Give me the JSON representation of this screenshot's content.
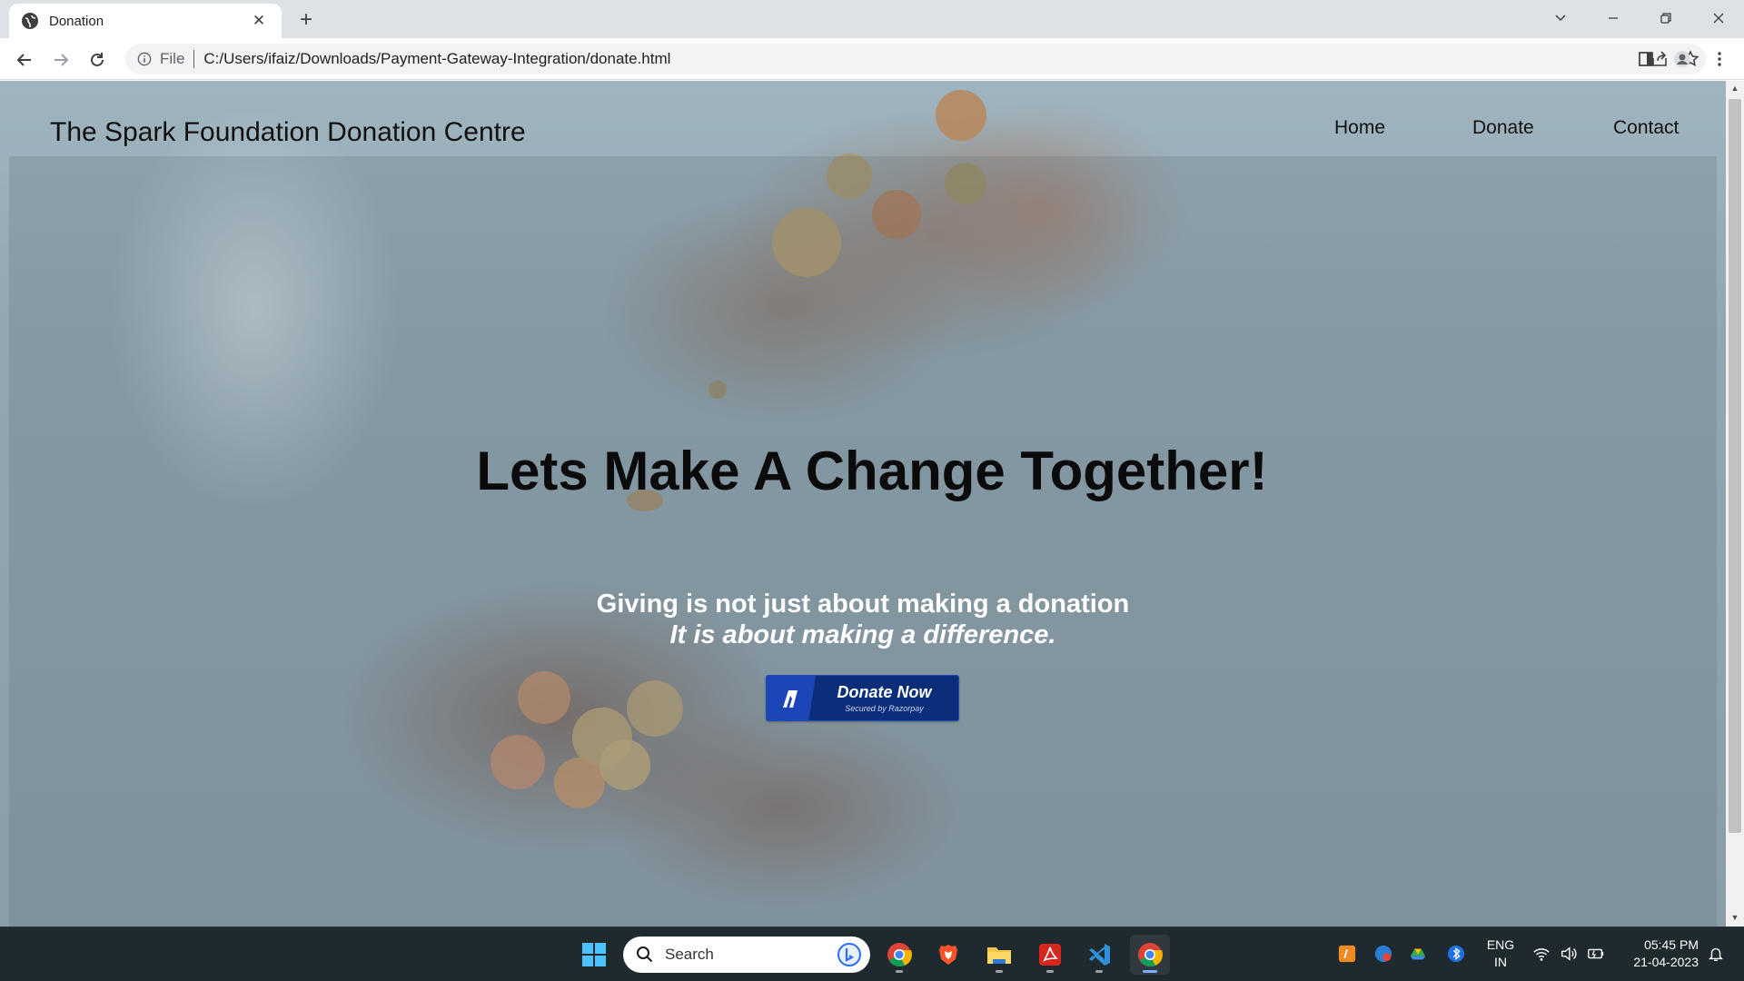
{
  "browser": {
    "tab_title": "Donation",
    "tab_close": "✕",
    "new_tab": "+",
    "url_scheme": "File",
    "url": "C:/Users/ifaiz/Downloads/Payment-Gateway-Integration/donate.html"
  },
  "page": {
    "brand": "The Spark Foundation Donation Centre",
    "nav": [
      "Home",
      "Donate",
      "Contact"
    ],
    "headline": "Lets Make A Change Together!",
    "tagline_line1": "Giving is not just about making a donation",
    "tagline_line2": "It is about making a difference.",
    "donate_button": {
      "label": "Donate Now",
      "secondary": "Secured by Razorpay",
      "color": "#0b2e7a",
      "logo_color": "#1c46b8"
    }
  },
  "taskbar": {
    "search_placeholder": "Search",
    "apps": [
      "start-icon",
      "chrome-icon",
      "brave-icon",
      "file-explorer-icon",
      "acrobat-icon",
      "vscode-icon",
      "chrome-active-icon"
    ],
    "language_line1": "ENG",
    "language_line2": "IN",
    "time": "05:45 PM",
    "date": "21-04-2023"
  }
}
